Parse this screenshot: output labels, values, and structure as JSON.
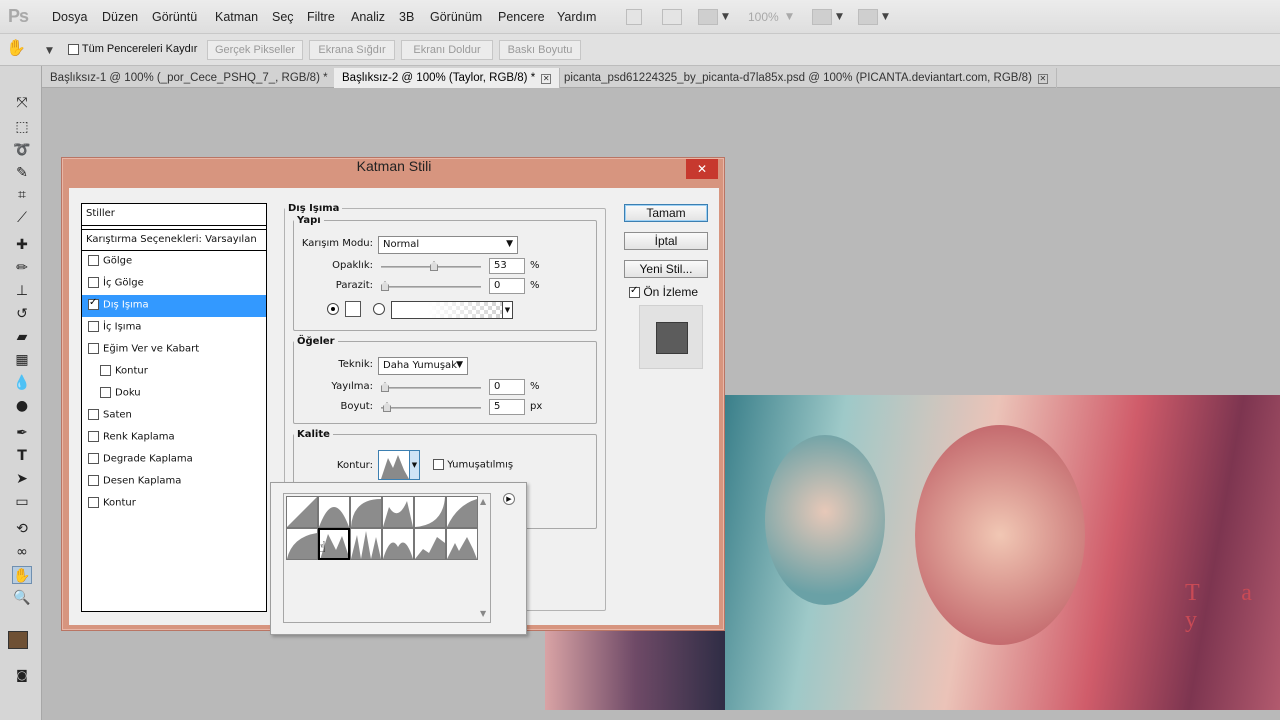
{
  "app": {
    "logo": "Ps"
  },
  "menu": [
    "Dosya",
    "Düzen",
    "Görüntü",
    "Katman",
    "Seç",
    "Filtre",
    "Analiz",
    "3B",
    "Görünüm",
    "Pencere",
    "Yardım"
  ],
  "menubar_zoom": "100%",
  "options": {
    "scroll_all_label": "Tüm Pencereleri Kaydır",
    "buttons": [
      "Gerçek Pikseller",
      "Ekrana Sığdır",
      "Ekranı Doldur",
      "Baskı Boyutu"
    ]
  },
  "tabs": [
    {
      "label": "Başlıksız-1 @ 100% (_por_Cece_PSHQ_7_, RGB/8) *",
      "active": false
    },
    {
      "label": "Başlıksız-2 @ 100% (Taylor, RGB/8) *",
      "active": true
    },
    {
      "label": "picanta_psd61224325_by_picanta-d7la85x.psd @ 100% (PICANTA.deviantart.com, RGB/8)",
      "active": false
    }
  ],
  "canvas_text": "T a y",
  "dialog": {
    "title": "Katman Stili",
    "close": "✕",
    "styles_header": "Stiller",
    "blend_options": "Karıştırma Seçenekleri: Varsayılan",
    "styles": [
      {
        "label": "Gölge",
        "checked": false,
        "selected": false,
        "sub": false
      },
      {
        "label": "İç Gölge",
        "checked": false,
        "selected": false,
        "sub": false
      },
      {
        "label": "Dış Işıma",
        "checked": true,
        "selected": true,
        "sub": false
      },
      {
        "label": "İç Işıma",
        "checked": false,
        "selected": false,
        "sub": false
      },
      {
        "label": "Eğim Ver ve Kabart",
        "checked": false,
        "selected": false,
        "sub": false
      },
      {
        "label": "Kontur",
        "checked": false,
        "selected": false,
        "sub": true
      },
      {
        "label": "Doku",
        "checked": false,
        "selected": false,
        "sub": true
      },
      {
        "label": "Saten",
        "checked": false,
        "selected": false,
        "sub": false
      },
      {
        "label": "Renk Kaplama",
        "checked": false,
        "selected": false,
        "sub": false
      },
      {
        "label": "Degrade Kaplama",
        "checked": false,
        "selected": false,
        "sub": false
      },
      {
        "label": "Desen Kaplama",
        "checked": false,
        "selected": false,
        "sub": false
      },
      {
        "label": "Kontur",
        "checked": false,
        "selected": false,
        "sub": false
      }
    ],
    "section_title": "Dış Işıma",
    "structure": {
      "legend": "Yapı",
      "blend_mode_label": "Karışım Modu:",
      "blend_mode": "Normal",
      "opacity_label": "Opaklık:",
      "opacity": "53",
      "noise_label": "Parazit:",
      "noise": "0",
      "unit_pct": "%"
    },
    "elements": {
      "legend": "Öğeler",
      "technique_label": "Teknik:",
      "technique": "Daha Yumuşak",
      "spread_label": "Yayılma:",
      "spread": "0",
      "size_label": "Boyut:",
      "size": "5",
      "unit_px": "px"
    },
    "quality": {
      "legend": "Kalite",
      "contour_label": "Kontur:",
      "antialias_label": "Yumuşatılmış"
    },
    "buttons": {
      "ok": "Tamam",
      "cancel": "İptal",
      "new_style": "Yeni Stil...",
      "preview_label": "Ön İzleme"
    }
  },
  "colors": {
    "dialog_frame": "#d7957f",
    "selected": "#3399ff",
    "close": "#c7392e"
  }
}
